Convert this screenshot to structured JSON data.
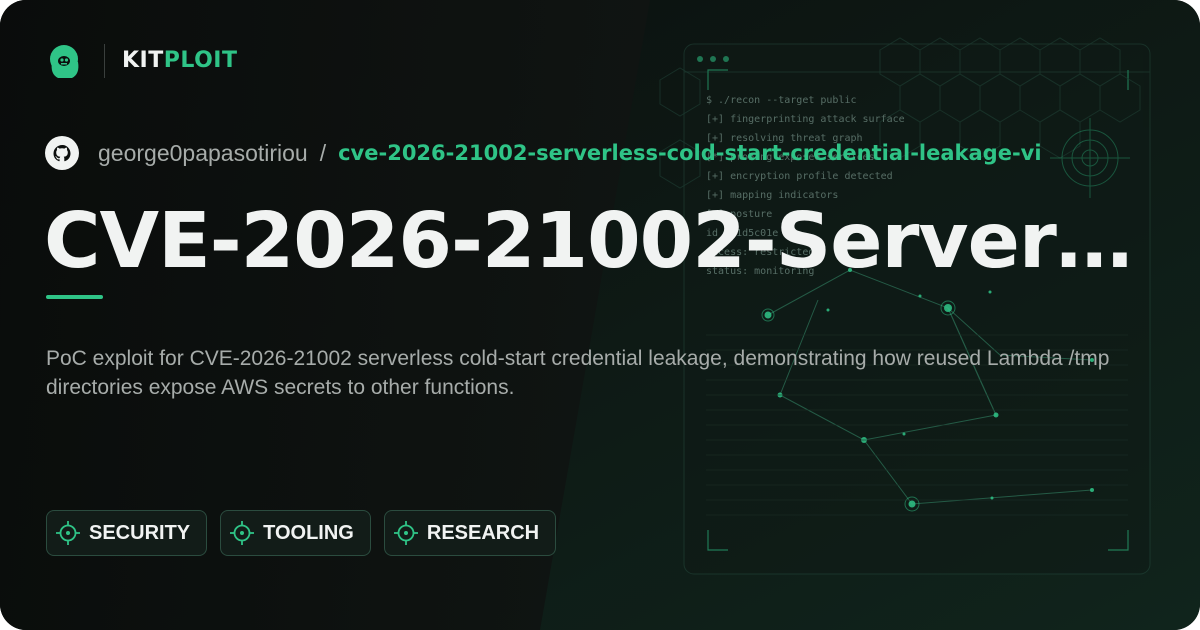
{
  "brand": {
    "name_part1": "KIT",
    "name_part2": "PLOIT"
  },
  "repo": {
    "owner": "george0papasotiriou",
    "separator": "/",
    "name": "cve-2026-21002-serverless-cold-start-credential-leakage-vi"
  },
  "title": "CVE-2026-21002-Server…",
  "description": "PoC exploit for CVE-2026-21002 serverless cold-start credential leakage, demonstrating how reused Lambda /tmp directories expose AWS secrets to other functions.",
  "tags": [
    "SECURITY",
    "TOOLING",
    "RESEARCH"
  ],
  "terminal": {
    "lines": [
      "$ ./recon --target public",
      "[+] fingerprinting attack surface",
      "[+] resolving threat graph",
      "[*] probing exposed services",
      "[+] encryption profile detected",
      "[+] mapping indicators",
      "[+] posture",
      "id 0x1d5c01e",
      "access: restricted",
      "status: monitoring"
    ]
  },
  "colors": {
    "background": "#0b0e0d",
    "accent": "#2fc487",
    "text_primary": "#f1f3f2",
    "text_secondary": "#a7acaa"
  },
  "icons": {
    "logo": "kitploit-mascot-icon",
    "repo": "github-icon",
    "tag": "crosshair-icon"
  }
}
